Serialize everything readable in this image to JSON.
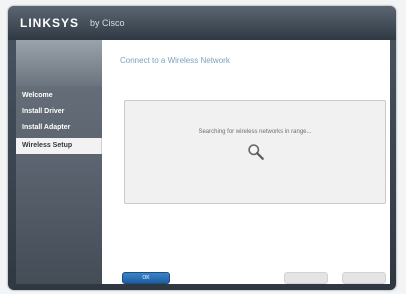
{
  "app": {
    "brand": "LINKSYS",
    "brand_suffix": "by Cisco"
  },
  "sidebar": {
    "items": [
      {
        "label": "Welcome",
        "active": false
      },
      {
        "label": "Install Driver",
        "active": false
      },
      {
        "label": "Install Adapter",
        "active": false
      },
      {
        "label": "Wireless Setup",
        "active": true
      }
    ]
  },
  "main": {
    "title": "Connect to a Wireless Network",
    "status": "Searching for wireless networks in range..."
  },
  "buttons": {
    "ok_label": "OK",
    "back_label": "",
    "next_label": ""
  },
  "colors": {
    "accent": "#1d5fa2",
    "title": "#7aa1bf",
    "chrome": "#3a4450"
  },
  "icons": {
    "status_icon": "magnifier-icon"
  }
}
